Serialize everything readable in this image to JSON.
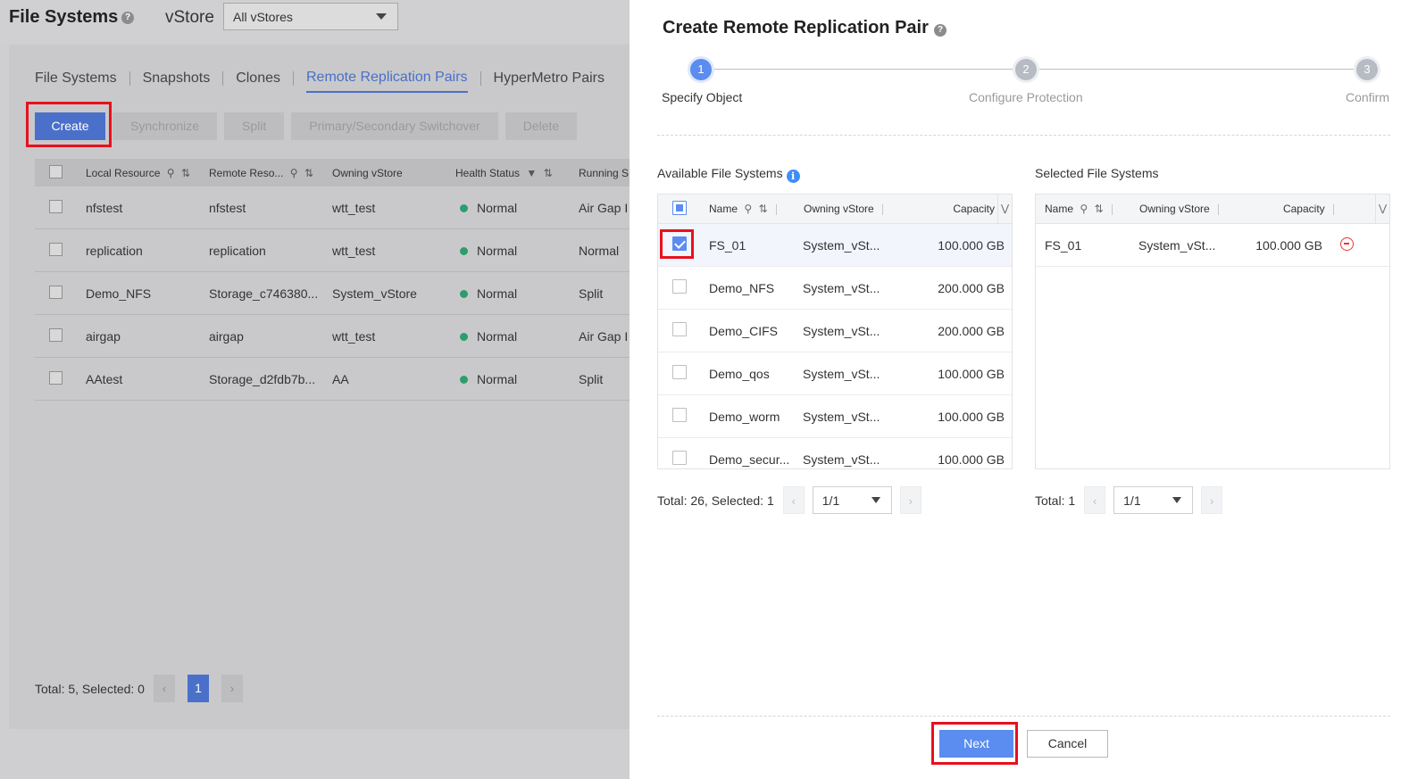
{
  "background": {
    "title": "File Systems",
    "vstore_label": "vStore",
    "vstore_select": "All vStores",
    "tabs": [
      "File Systems",
      "Snapshots",
      "Clones",
      "Remote Replication Pairs",
      "HyperMetro Pairs"
    ],
    "active_tab": "Remote Replication Pairs",
    "buttons": {
      "create": "Create",
      "synchronize": "Synchronize",
      "split": "Split",
      "switchover": "Primary/Secondary Switchover",
      "delete": "Delete"
    },
    "columns": {
      "local": "Local Resource",
      "remote": "Remote Reso...",
      "owning": "Owning vStore",
      "health": "Health Status",
      "running": "Running S"
    },
    "rows": [
      {
        "local": "nfstest",
        "remote": "nfstest",
        "owning": "wtt_test",
        "health": "Normal",
        "running": "Air Gap I"
      },
      {
        "local": "replication",
        "remote": "replication",
        "owning": "wtt_test",
        "health": "Normal",
        "running": "Normal"
      },
      {
        "local": "Demo_NFS",
        "remote": "Storage_c746380...",
        "owning": "System_vStore",
        "health": "Normal",
        "running": "Split"
      },
      {
        "local": "airgap",
        "remote": "airgap",
        "owning": "wtt_test",
        "health": "Normal",
        "running": "Air Gap I"
      },
      {
        "local": "AAtest",
        "remote": "Storage_d2fdb7b...",
        "owning": "AA",
        "health": "Normal",
        "running": "Split"
      }
    ],
    "footer": {
      "summary": "Total: 5, Selected: 0",
      "page": "1"
    }
  },
  "dialog": {
    "title": "Create Remote Replication Pair",
    "steps": [
      {
        "num": "1",
        "label": "Specify Object",
        "state": "active"
      },
      {
        "num": "2",
        "label": "Configure Protection",
        "state": "pending"
      },
      {
        "num": "3",
        "label": "Confirm",
        "state": "pending"
      }
    ],
    "available": {
      "label": "Available File Systems",
      "columns": {
        "name": "Name",
        "owning": "Owning vStore",
        "capacity": "Capacity"
      },
      "rows": [
        {
          "name": "FS_01",
          "owning": "System_vSt...",
          "capacity": "100.000 GB",
          "checked": true
        },
        {
          "name": "Demo_NFS",
          "owning": "System_vSt...",
          "capacity": "200.000 GB",
          "checked": false
        },
        {
          "name": "Demo_CIFS",
          "owning": "System_vSt...",
          "capacity": "200.000 GB",
          "checked": false
        },
        {
          "name": "Demo_qos",
          "owning": "System_vSt...",
          "capacity": "100.000 GB",
          "checked": false
        },
        {
          "name": "Demo_worm",
          "owning": "System_vSt...",
          "capacity": "100.000 GB",
          "checked": false
        },
        {
          "name": "Demo_secur...",
          "owning": "System_vSt...",
          "capacity": "100.000 GB",
          "checked": false
        }
      ],
      "summary": "Total: 26, Selected: 1",
      "page": "1/1"
    },
    "selected": {
      "label": "Selected File Systems",
      "columns": {
        "name": "Name",
        "owning": "Owning vStore",
        "capacity": "Capacity"
      },
      "rows": [
        {
          "name": "FS_01",
          "owning": "System_vSt...",
          "capacity": "100.000 GB"
        }
      ],
      "summary": "Total: 1",
      "page": "1/1"
    },
    "buttons": {
      "next": "Next",
      "cancel": "Cancel"
    }
  },
  "colors": {
    "accent": "#5b8cf0",
    "highlight": "#e8101e",
    "status_normal": "#2c9e6e"
  }
}
